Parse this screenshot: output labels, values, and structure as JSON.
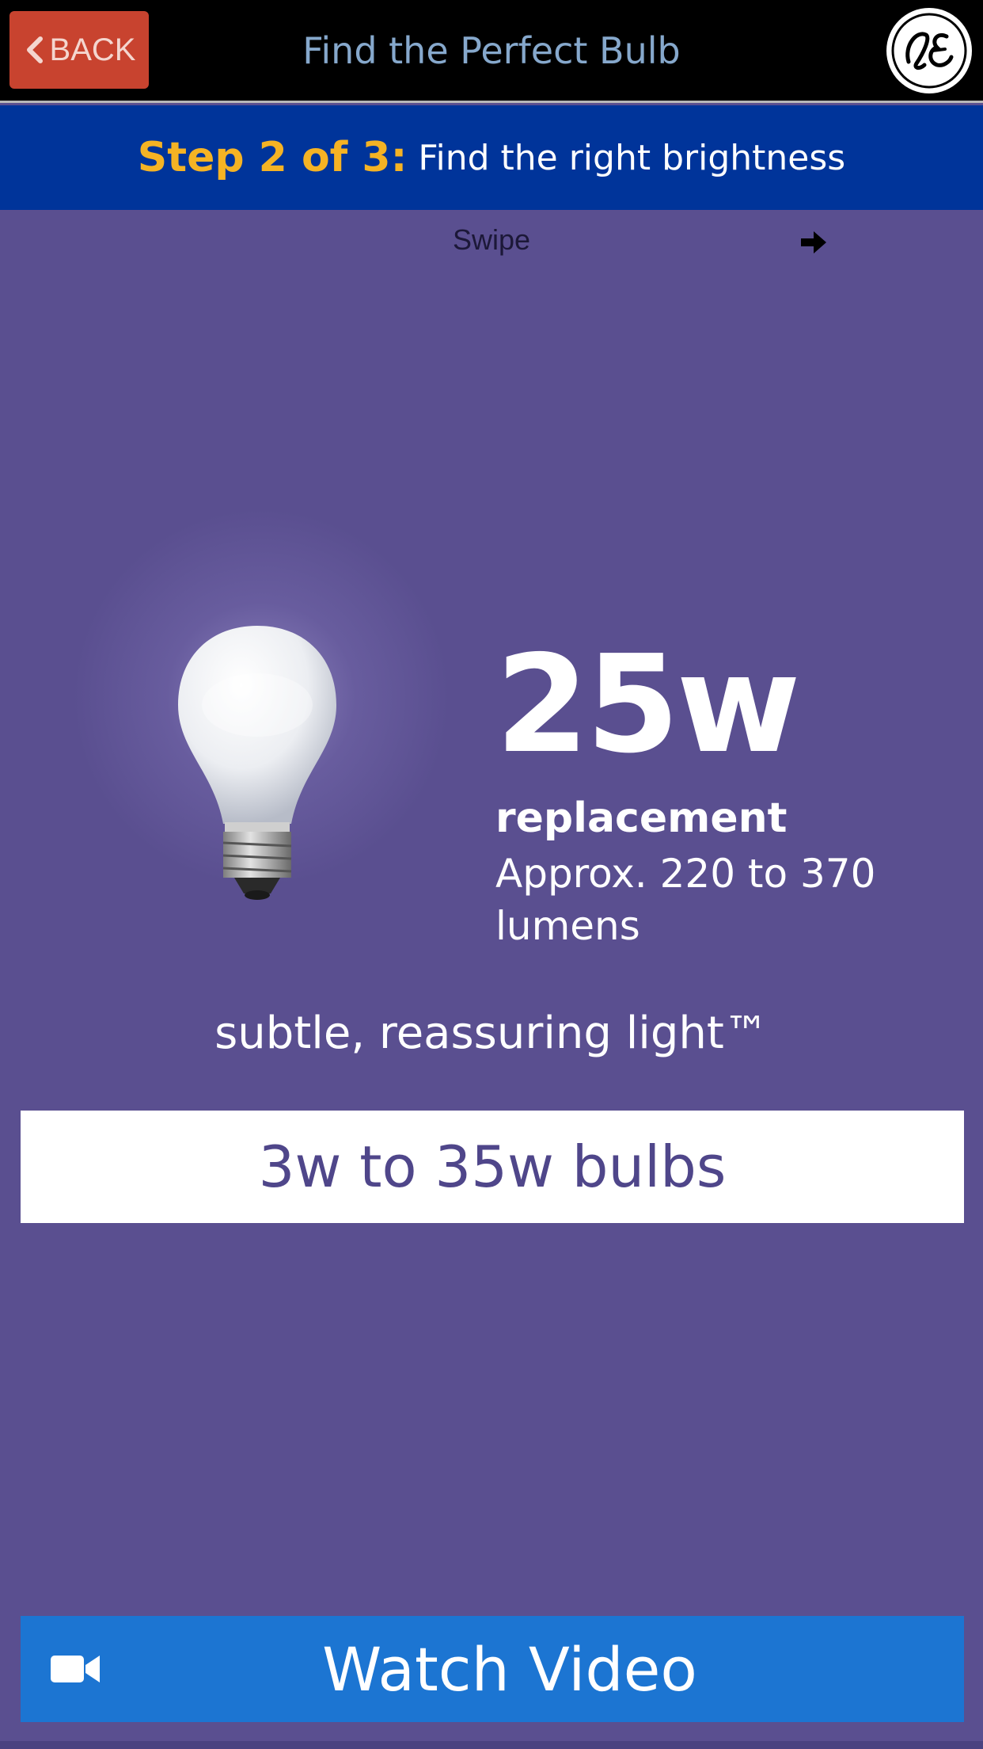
{
  "header": {
    "back_label": "BACK",
    "title": "Find the Perfect Bulb",
    "logo_icon": "ge-logo-icon"
  },
  "step": {
    "label": "Step 2 of 3:",
    "text": "Find the right brightness"
  },
  "swipe": {
    "label": "Swipe",
    "arrow_icon": "arrow-right-icon"
  },
  "bulb": {
    "watt": "25w",
    "replacement_label": "replacement",
    "lumens_line1": "Approx. 220 to 370",
    "lumens_line2": "lumens",
    "tagline": "subtle, reassuring light™"
  },
  "range": {
    "label": "3w to 35w bulbs"
  },
  "video": {
    "label": "Watch Video",
    "icon": "video-camera-icon"
  },
  "colors": {
    "background": "#5a4f90",
    "header": "#000000",
    "back_button": "#c8432f",
    "step_banner": "#00349a",
    "step_highlight": "#f5b324",
    "video_button": "#1c75d2"
  }
}
